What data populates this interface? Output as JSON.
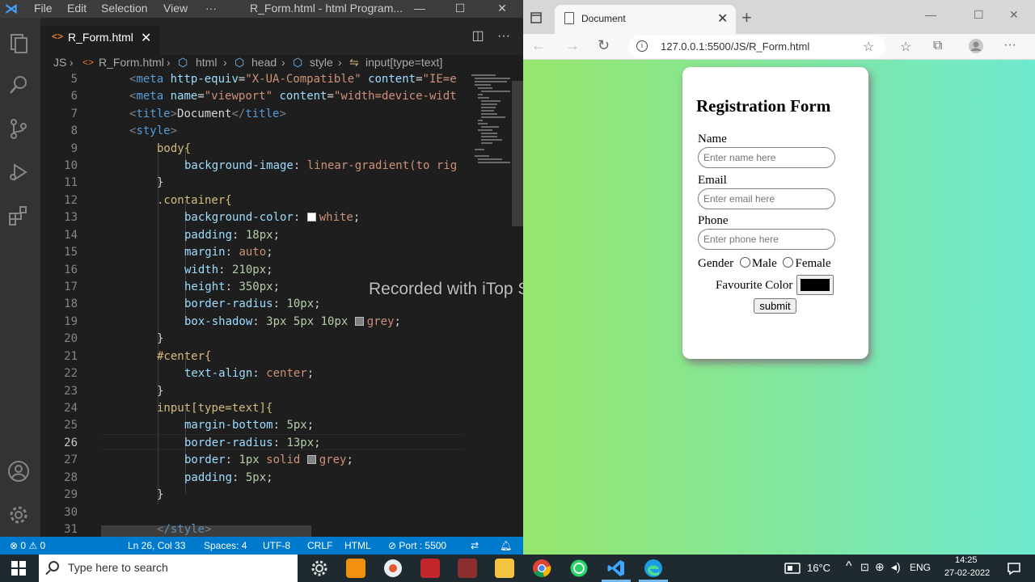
{
  "vscode": {
    "menu": [
      "File",
      "Edit",
      "Selection",
      "View",
      "···"
    ],
    "title": "R_Form.html - html Program...",
    "tab": {
      "label": "R_Form.html",
      "icon": "<>"
    },
    "breadcrumb": [
      "JS",
      "R_Form.html",
      "html",
      "head",
      "style",
      "input[type=text]"
    ],
    "line_numbers": [
      "5",
      "6",
      "7",
      "8",
      "9",
      "10",
      "11",
      "12",
      "13",
      "14",
      "15",
      "16",
      "17",
      "18",
      "19",
      "20",
      "21",
      "22",
      "23",
      "24",
      "25",
      "26",
      "27",
      "28",
      "29",
      "30",
      "31"
    ],
    "active_line": "26",
    "code": {
      "l5_a": "meta",
      "l5_b": "http-equiv",
      "l5_c": "\"X-UA-Compatible\"",
      "l5_d": "content",
      "l5_e": "\"IE=e",
      "l6_a": "meta",
      "l6_b": "name",
      "l6_c": "\"viewport\"",
      "l6_d": "content",
      "l6_e": "\"width=device-widt",
      "l7_a": "title",
      "l7_b": "Document",
      "l7_c": "title",
      "l8_a": "style",
      "l9": "body{",
      "l10_p": "background-image",
      "l10_v": "linear-gradient(to rig",
      "l11": "}",
      "l12": ".container{",
      "l13_p": "background-color",
      "l13_v": "white",
      "l14_p": "padding",
      "l14_v": "18px",
      "l15_p": "margin",
      "l15_v": "auto",
      "l16_p": "width",
      "l16_v": "210px",
      "l17_p": "height",
      "l17_v": "350px",
      "l18_p": "border-radius",
      "l18_v": "10px",
      "l19_p": "box-shadow",
      "l19_v1": "3px",
      "l19_v2": "5px",
      "l19_v3": "10px",
      "l19_v4": "grey",
      "l20": "}",
      "l21": "#center{",
      "l22_p": "text-align",
      "l22_v": "center",
      "l23": "}",
      "l24_a": "input",
      "l24_b": "[type=text]{",
      "l25_p": "margin-bottom",
      "l25_v": "5px",
      "l26_p": "border-radius",
      "l26_v": "13px",
      "l27_p": "border",
      "l27_v1": "1px",
      "l27_v2": "solid",
      "l27_v3": "grey",
      "l28_p": "padding",
      "l28_v": "5px",
      "l29": "}",
      "l31_a": "/style"
    },
    "status": {
      "problems": "⊗ 0 ⚠ 0",
      "position": "Ln 26, Col 33",
      "spaces": "Spaces: 4",
      "encoding": "UTF-8",
      "eol": "CRLF",
      "language": "HTML",
      "port": "⊘ Port : 5500"
    }
  },
  "watermark": "Recorded with iTop Screen Recorder",
  "edge": {
    "tab_title": "Document",
    "url": "127.0.0.1:5500/JS/R_Form.html",
    "page": {
      "title": "Registration Form",
      "name_label": "Name",
      "name_placeholder": "Enter name here",
      "email_label": "Email",
      "email_placeholder": "Enter email here",
      "phone_label": "Phone",
      "phone_placeholder": "Enter phone here",
      "gender_label": "Gender",
      "gender_male": "Male",
      "gender_female": "Female",
      "fav_color_label": "Favourite Color",
      "fav_color_value": "#000000",
      "submit_label": "submit"
    },
    "gradient": [
      "#96e66c",
      "#6ee8cf"
    ]
  },
  "taskbar": {
    "search_placeholder": "Type here to search",
    "temperature": "16°C",
    "language": "ENG",
    "time": "14:25",
    "date": "27-02-2022"
  }
}
